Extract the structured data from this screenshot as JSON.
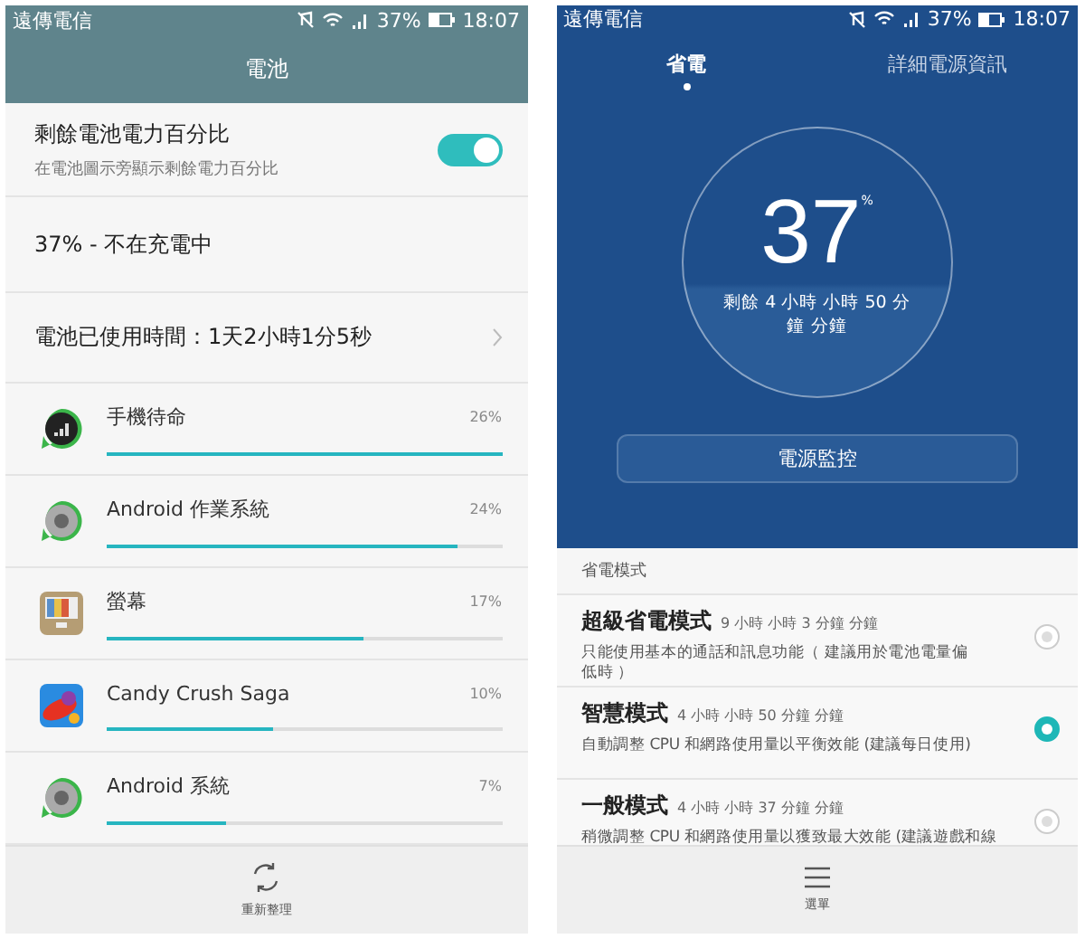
{
  "left": {
    "status_bar": {
      "carrier": "遠傳電信",
      "battery": "37%",
      "time": "18:07"
    },
    "title": "電池",
    "percentage_setting": {
      "label": "剩餘電池電力百分比",
      "description": "在電池圖示旁顯示剩餘電力百分比",
      "on": true
    },
    "charge_status": "37% - 不在充電中",
    "usage_time": "電池已使用時間：1天2小時1分5秒",
    "apps": [
      {
        "name": "手機待命",
        "percent": "26%",
        "level": 1.0,
        "kind": "signal"
      },
      {
        "name": "Android 作業系統",
        "percent": "24%",
        "level": 0.89,
        "kind": "android"
      },
      {
        "name": "螢幕",
        "percent": "17%",
        "level": 0.65,
        "kind": "screen"
      },
      {
        "name": "Candy Crush Saga",
        "percent": "10%",
        "level": 0.42,
        "kind": "candy"
      },
      {
        "name": "Android 系統",
        "percent": "7%",
        "level": 0.3,
        "kind": "android"
      }
    ],
    "bottom_action": "重新整理"
  },
  "right": {
    "status_bar": {
      "carrier": "遠傳電信",
      "battery": "37%",
      "time": "18:07"
    },
    "tabs": [
      {
        "label": "省電",
        "selected": true
      },
      {
        "label": "詳細電源資訊",
        "selected": false
      }
    ],
    "gauge": {
      "value": "37",
      "unit": "%",
      "remaining": "剩餘 4 小時 小時 50 分鐘 分鐘"
    },
    "monitor_button": "電源監控",
    "section": "省電模式",
    "modes": [
      {
        "name": "超級省電模式",
        "time": "9 小時 小時 3 分鐘 分鐘",
        "description": "只能使用基本的通話和訊息功能（ 建議用於電池電量偏低時 ）",
        "selected": false
      },
      {
        "name": "智慧模式",
        "time": "4 小時 小時 50 分鐘 分鐘",
        "description": "自動調整 CPU 和網路使用量以平衡效能 (建議每日使用)",
        "selected": true
      },
      {
        "name": "一般模式",
        "time": "4 小時 小時 37 分鐘 分鐘",
        "description": "稍微調整 CPU 和網路使用量以獲致最大效能 (建議遊戲和線",
        "selected": false
      }
    ],
    "bottom_action": "選單"
  }
}
